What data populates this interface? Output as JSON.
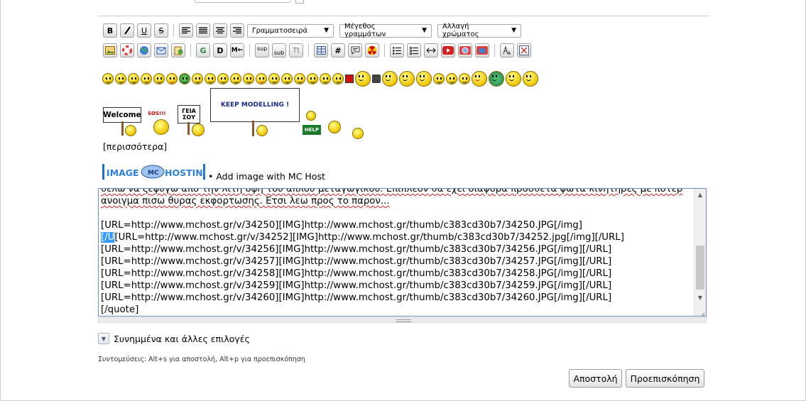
{
  "toolbar": {
    "row1": [
      "B",
      "I",
      "U",
      "S"
    ],
    "font_select": "Γραμματοσειρά",
    "size_select": "Μέγεθος γραμμάτων",
    "color_select": "Αλλαγή χρώματος",
    "row2_text_buttons": {
      "g": "G",
      "d": "D",
      "m": "M←",
      "sup": "sup",
      "sub": "sub",
      "tt": "Tt",
      "hash": "#"
    }
  },
  "more_smilies": "[περισσότερα]",
  "mc_host": {
    "logo_left": "IMAGE",
    "logo_mid": "MC",
    "logo_right": "HOSTING",
    "label": "• Add image with MC Host"
  },
  "signs": {
    "welcome": "Welcome",
    "sos": "SOS!!!",
    "geia": "ΓΕΙΑ ΣΟΥ",
    "keep": "KEEP MODELLING !",
    "help": "HELP"
  },
  "editor": {
    "lines": [
      "θελω να ξεφυγω απο την λιτη οψη του απλου μεταγωγικου. Επιπλεον θα εχει διαφορα προσθετα φωτα κινητηρες με ποτερ",
      "ανοιγμα πισω θυρας εκφορτωσης. Ετσι λεω προς το παρον...",
      "",
      "[URL=http://www.mchost.gr/v/34250][IMG]http://www.mchost.gr/thumb/c383cd30b7/34250.JPG[/img]",
      "[URL=http://www.mchost.gr/v/34252][IMG]http://www.mchost.gr/thumb/c383cd30b7/34252.jpg[/img][/URL]",
      "[URL=http://www.mchost.gr/v/34256][IMG]http://www.mchost.gr/thumb/c383cd30b7/34256.JPG[/img][/URL]",
      "[URL=http://www.mchost.gr/v/34257][IMG]http://www.mchost.gr/thumb/c383cd30b7/34257.JPG[/img][/URL]",
      "[URL=http://www.mchost.gr/v/34258][IMG]http://www.mchost.gr/thumb/c383cd30b7/34258.JPG[/img][/URL]",
      "[URL=http://www.mchost.gr/v/34259][IMG]http://www.mchost.gr/thumb/c383cd30b7/34259.JPG[/img][/URL]",
      "[URL=http://www.mchost.gr/v/34260][IMG]http://www.mchost.gr/thumb/c383cd30b7/34260.JPG[/img][/URL]",
      "[/quote]"
    ],
    "selected_text": "[/U",
    "line5_rest": "[URL=http://www.mchost.gr/v/34252][IMG]http://www.mchost.gr/thumb/c383cd30b7/34252.jpg[/img][/URL]"
  },
  "attachments_label": "Συνημμένα και άλλες επιλογές",
  "shortcuts": "Συντομεύσεις: Alt+s για αποστολή, Alt+p για προεπισκόπηση",
  "buttons": {
    "submit": "Αποστολή",
    "preview": "Προεπισκόπηση"
  },
  "colors": {
    "editor_border": "#6a8fc0",
    "selection": "#3399ff",
    "youtube_red": "#d92020"
  }
}
